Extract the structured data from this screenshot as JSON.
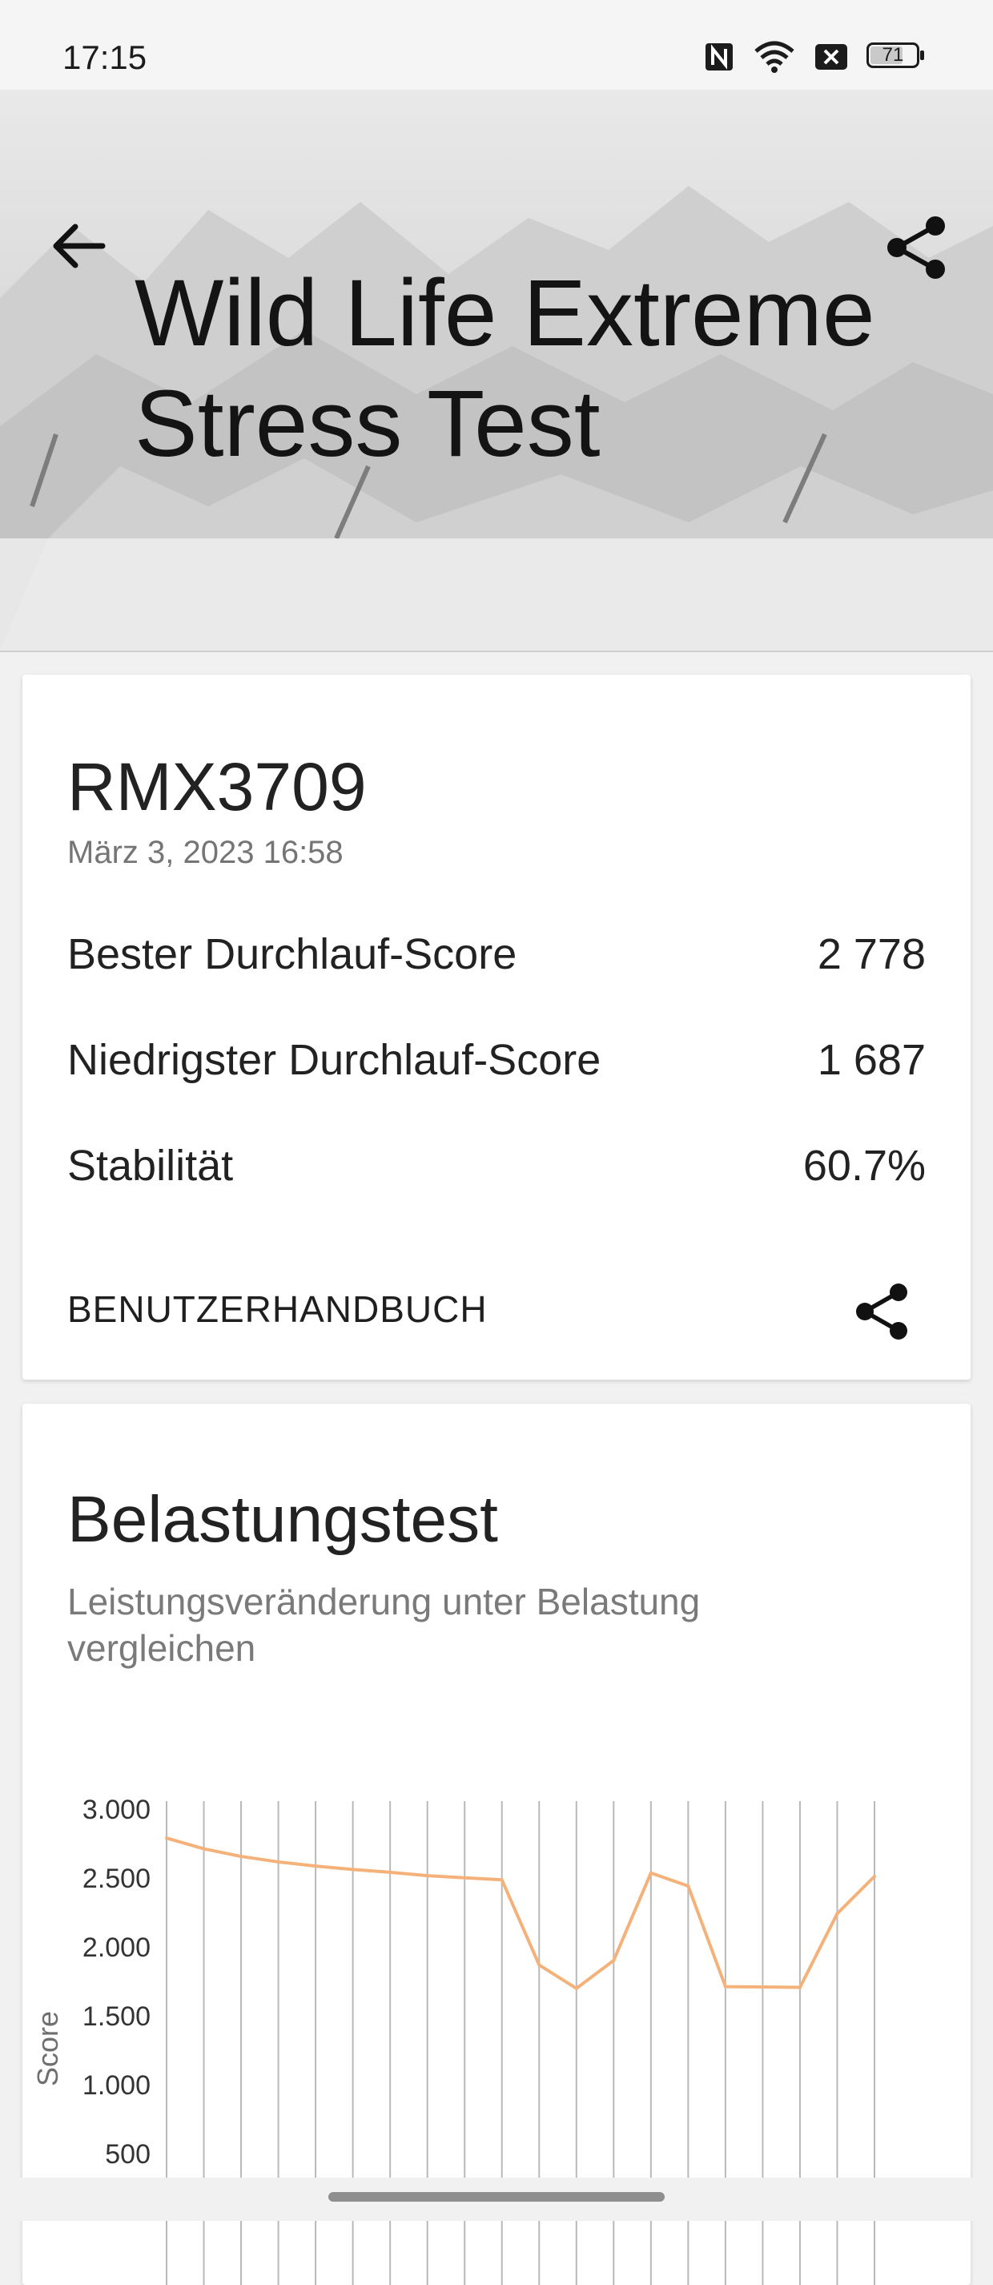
{
  "status_bar": {
    "time": "17:15",
    "battery": "71",
    "icons": [
      "nfc-icon",
      "wifi-icon",
      "x-box-icon",
      "battery-icon"
    ]
  },
  "header": {
    "title": "Wild Life Extreme Stress Test",
    "back_icon": "arrow-left-icon",
    "share_icon": "share-icon"
  },
  "result": {
    "device": "RMX3709",
    "date": "März 3, 2023 16:58",
    "metrics": [
      {
        "label": "Bester Durchlauf-Score",
        "value": "2 778"
      },
      {
        "label": "Niedrigster Durchlauf-Score",
        "value": "1 687"
      },
      {
        "label": "Stabilität",
        "value": "60.7%"
      }
    ],
    "manual_label": "BENUTZERHANDBUCH",
    "share_icon": "share-icon"
  },
  "stress": {
    "title": "Belastungstest",
    "subtitle": "Leistungsveränderung unter Belastung vergleichen"
  },
  "chart_data": {
    "type": "line",
    "ylabel": "Score",
    "xlabel": "",
    "y_ticks": [
      "3.000",
      "2.500",
      "2.000",
      "1.500",
      "1.000",
      "500"
    ],
    "y_tick_values": [
      3000,
      2500,
      2000,
      1500,
      1000,
      500
    ],
    "ylim": [
      0,
      3000
    ],
    "grid": "vertical",
    "line_color": "#f4b27a",
    "series": [
      {
        "values": [
          2778,
          2700,
          2645,
          2605,
          2575,
          2550,
          2530,
          2505,
          2490,
          2475,
          1857,
          1687,
          1890,
          2525,
          2430,
          1700,
          1698,
          1695,
          2230,
          2500
        ]
      }
    ]
  }
}
